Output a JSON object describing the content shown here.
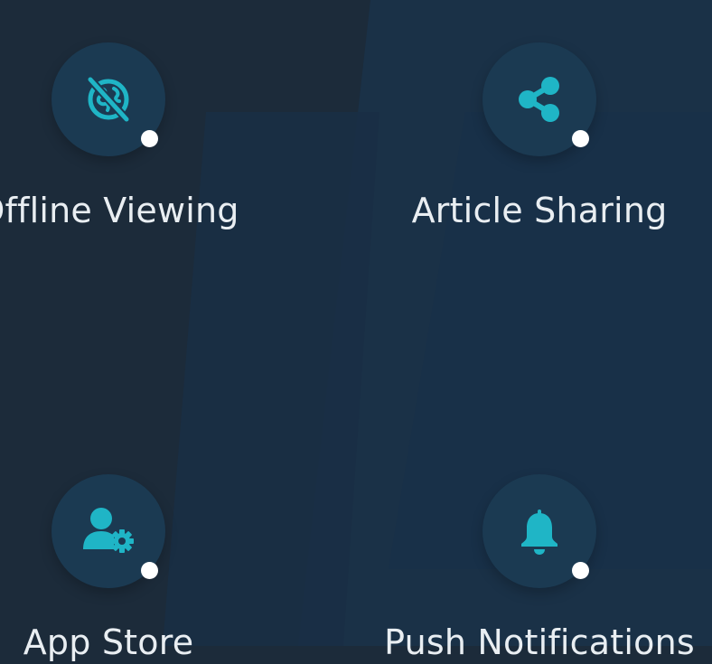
{
  "colors": {
    "background": "#1c2b3a",
    "panel": "#1a3047",
    "circle": "#1b3a52",
    "accent": "#1fb5c6",
    "dot": "#ffffff",
    "label": "#e9eef2"
  },
  "features": [
    {
      "label": "Offline Viewing",
      "icon": "offline-globe-icon"
    },
    {
      "label": "Article Sharing",
      "icon": "share-icon"
    },
    {
      "label": "App Store",
      "icon": "user-gear-icon"
    },
    {
      "label": "Push Notifications",
      "icon": "bell-icon"
    }
  ]
}
